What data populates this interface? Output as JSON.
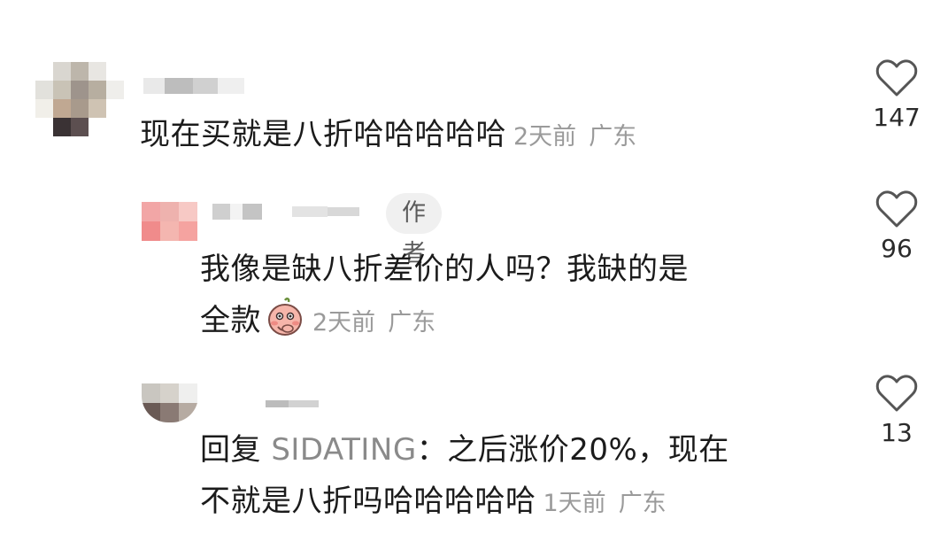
{
  "comments": [
    {
      "text": "现在买就是八折哈哈哈哈哈",
      "time": "2天前",
      "location": "广东",
      "likes": "147"
    },
    {
      "badge": "作者",
      "text_line1": "我像是缺八折差价的人吗？我缺的是",
      "text_line2": "全款",
      "emoji": "blush-emoji",
      "time": "2天前",
      "location": "广东",
      "likes": "96"
    },
    {
      "reply_prefix": "回复",
      "reply_target": "SIDATING",
      "text_line1_rest": "：之后涨价20%，现在",
      "text_line2": "不就是八折吗哈哈哈哈哈",
      "time": "1天前",
      "location": "广东",
      "likes": "13"
    }
  ],
  "icons": {
    "like": "heart-outline-icon"
  },
  "colors": {
    "text": "#1b1b1b",
    "meta": "#9a9a9a",
    "badge_bg": "#f0f0f0",
    "icon": "#555555"
  }
}
